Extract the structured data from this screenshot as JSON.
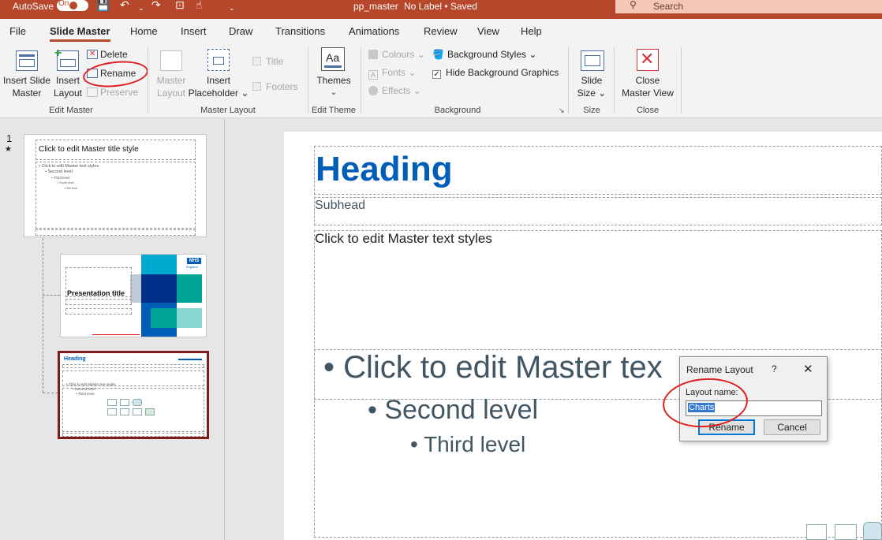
{
  "titlebar": {
    "autosave_label": "AutoSave",
    "autosave_state": "On",
    "document_name": "pp_master",
    "label_status": "No Label • Saved",
    "search_placeholder": "Search"
  },
  "tabs": [
    {
      "label": "File"
    },
    {
      "label": "Slide Master"
    },
    {
      "label": "Home"
    },
    {
      "label": "Insert"
    },
    {
      "label": "Draw"
    },
    {
      "label": "Transitions"
    },
    {
      "label": "Animations"
    },
    {
      "label": "Review"
    },
    {
      "label": "View"
    },
    {
      "label": "Help"
    }
  ],
  "ribbon": {
    "insert_slide_master": [
      "Insert Slide",
      "Master"
    ],
    "insert_layout": [
      "Insert",
      "Layout"
    ],
    "delete": "Delete",
    "rename": "Rename",
    "preserve": "Preserve",
    "group_edit_master": "Edit Master",
    "master_layout_btn": [
      "Master",
      "Layout"
    ],
    "insert_placeholder": [
      "Insert",
      "Placeholder"
    ],
    "title_check": "Title",
    "footers_check": "Footers",
    "group_master_layout": "Master Layout",
    "themes": "Themes",
    "group_edit_theme": "Edit Theme",
    "colours": "Colours",
    "fonts": "Fonts",
    "effects": "Effects",
    "background_styles": "Background Styles",
    "hide_background_graphics": "Hide Background Graphics",
    "group_background": "Background",
    "slide_size": [
      "Slide",
      "Size"
    ],
    "group_size": "Size",
    "close_master_view": [
      "Close",
      "Master View"
    ],
    "group_close": "Close"
  },
  "thumbs": {
    "slide_number": "1",
    "master_title": "Click to edit Master title style",
    "master_body": [
      "• Click to edit Master text styles",
      "• Second level",
      "• Third level",
      "• Fourth level",
      "• Fifth level"
    ],
    "layout2_title": "Presentation title",
    "layout2_logo": "NHS",
    "layout2_logo_sub": "England",
    "layout3_heading": "Heading"
  },
  "slide": {
    "heading": "Heading",
    "subhead": "Subhead",
    "body_text": "Click to edit Master text styles",
    "level1": "• Click to edit Master tex",
    "level2": "• Second level",
    "level3": "• Third level"
  },
  "dialog": {
    "title": "Rename Layout",
    "help": "?",
    "close": "✕",
    "label": "Layout name:",
    "value": "Charts",
    "rename_button": "Rename",
    "cancel_button": "Cancel"
  },
  "colors": {
    "titlebar": "#b7472a",
    "accent": "#b7472a",
    "nhs_blue": "#005eb8",
    "selected_thumb": "#7b1e1e",
    "annotation_red": "#e02020"
  }
}
